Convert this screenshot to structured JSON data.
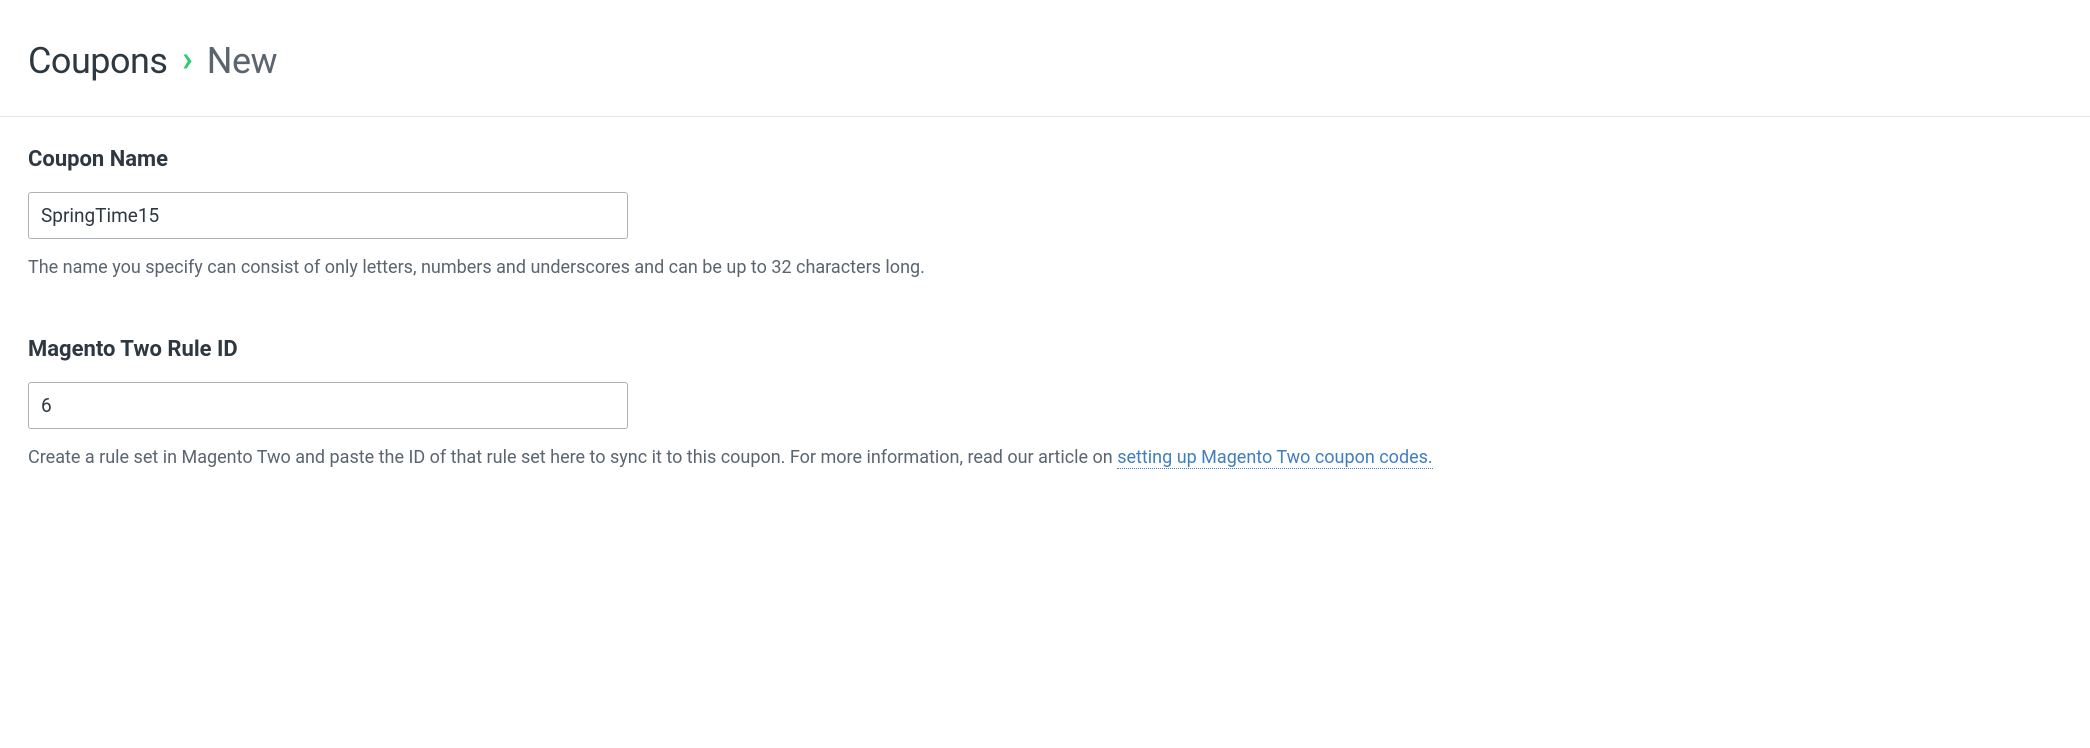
{
  "breadcrumb": {
    "root": "Coupons",
    "separator": "›",
    "current": "New"
  },
  "form": {
    "coupon_name": {
      "label": "Coupon Name",
      "value": "SpringTime15",
      "help": "The name you specify can consist of only letters, numbers and underscores and can be up to 32 characters long."
    },
    "rule_id": {
      "label": "Magento Two Rule ID",
      "value": "6",
      "help_prefix": "Create a rule set in Magento Two and paste the ID of that rule set here to sync it to this coupon. For more information, read our article on ",
      "help_link_text": "setting up Magento Two coupon codes."
    }
  }
}
